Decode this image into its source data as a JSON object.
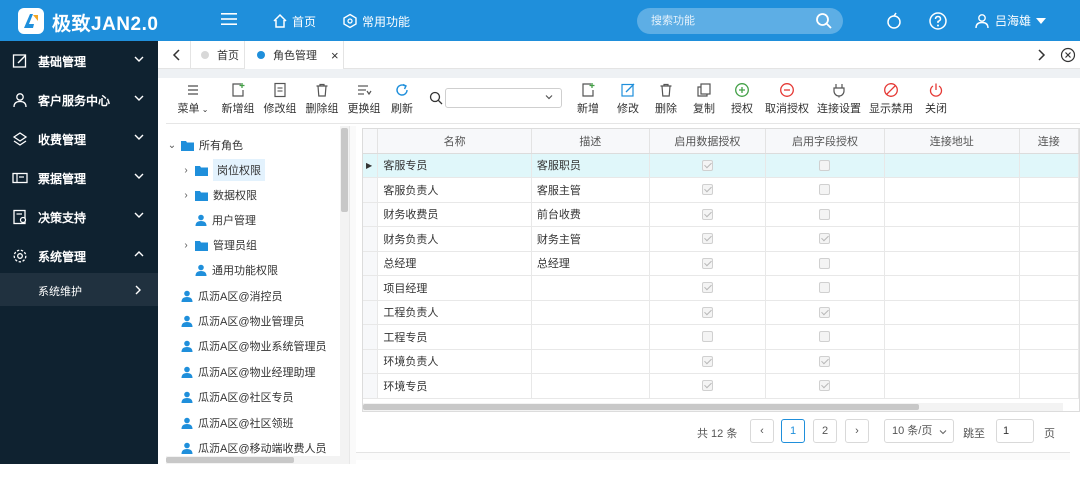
{
  "app": {
    "title": "极致JAN2.0"
  },
  "topnav": {
    "home": "首页",
    "common": "常用功能"
  },
  "search": {
    "placeholder": "搜索功能"
  },
  "user": {
    "name": "吕海雄"
  },
  "colors": {
    "topbar": "#1f8fdb",
    "sidebar": "#0f2230",
    "accent": "#1f8fdb",
    "danger": "#e53935",
    "success": "#43a047"
  },
  "sidebar": {
    "items": [
      {
        "label": "基础管理",
        "icon": "edit-icon"
      },
      {
        "label": "客户服务中心",
        "icon": "person-icon"
      },
      {
        "label": "收费管理",
        "icon": "payment-icon"
      },
      {
        "label": "票据管理",
        "icon": "ticket-icon"
      },
      {
        "label": "决策支持",
        "icon": "report-icon"
      },
      {
        "label": "系统管理",
        "icon": "gear-icon"
      }
    ],
    "sub_item": "系统维护"
  },
  "tabs": [
    {
      "label": "首页"
    },
    {
      "label": "角色管理"
    }
  ],
  "toolbar": {
    "menu": "菜单",
    "add_group": "新增组",
    "edit_group": "修改组",
    "delete_group": "删除组",
    "change_group": "更换组",
    "refresh": "刷新",
    "add": "新增",
    "edit": "修改",
    "delete": "删除",
    "copy": "复制",
    "authorize": "授权",
    "cancel_authorize": "取消授权",
    "connect_settings": "连接设置",
    "show_disabled": "显示禁用",
    "close": "关闭"
  },
  "tree": {
    "root": "所有角色",
    "groups": [
      {
        "label": "岗位权限"
      },
      {
        "label": "数据权限"
      },
      {
        "label": "用户管理"
      },
      {
        "label": "管理员组"
      },
      {
        "label": "通用功能权限"
      }
    ],
    "users": [
      "瓜沥A区@消控员",
      "瓜沥A区@物业管理员",
      "瓜沥A区@物业系统管理员",
      "瓜沥A区@物业经理助理",
      "瓜沥A区@社区专员",
      "瓜沥A区@社区领班",
      "瓜沥A区@移动端收费人员"
    ]
  },
  "grid": {
    "columns": [
      "名称",
      "描述",
      "启用数据授权",
      "启用字段授权",
      "连接地址",
      "连接"
    ],
    "rows": [
      {
        "name": "客服专员",
        "desc": "客服职员",
        "data_auth": true,
        "field_auth": false
      },
      {
        "name": "客服负责人",
        "desc": "客服主管",
        "data_auth": true,
        "field_auth": false
      },
      {
        "name": "财务收费员",
        "desc": "前台收费",
        "data_auth": true,
        "field_auth": false
      },
      {
        "name": "财务负责人",
        "desc": "财务主管",
        "data_auth": true,
        "field_auth": true
      },
      {
        "name": "总经理",
        "desc": "总经理",
        "data_auth": true,
        "field_auth": false
      },
      {
        "name": "项目经理",
        "desc": "",
        "data_auth": true,
        "field_auth": false
      },
      {
        "name": "工程负责人",
        "desc": "",
        "data_auth": true,
        "field_auth": true
      },
      {
        "name": "工程专员",
        "desc": "",
        "data_auth": false,
        "field_auth": false
      },
      {
        "name": "环境负责人",
        "desc": "",
        "data_auth": true,
        "field_auth": true
      },
      {
        "name": "环境专员",
        "desc": "",
        "data_auth": true,
        "field_auth": true
      }
    ]
  },
  "pager": {
    "total": "共 12 条",
    "prev": "‹",
    "pages": [
      "1",
      "2"
    ],
    "next": "›",
    "page_size": "10 条/页",
    "jump_label": "跳至",
    "jump_value": "1",
    "page_unit": "页"
  }
}
